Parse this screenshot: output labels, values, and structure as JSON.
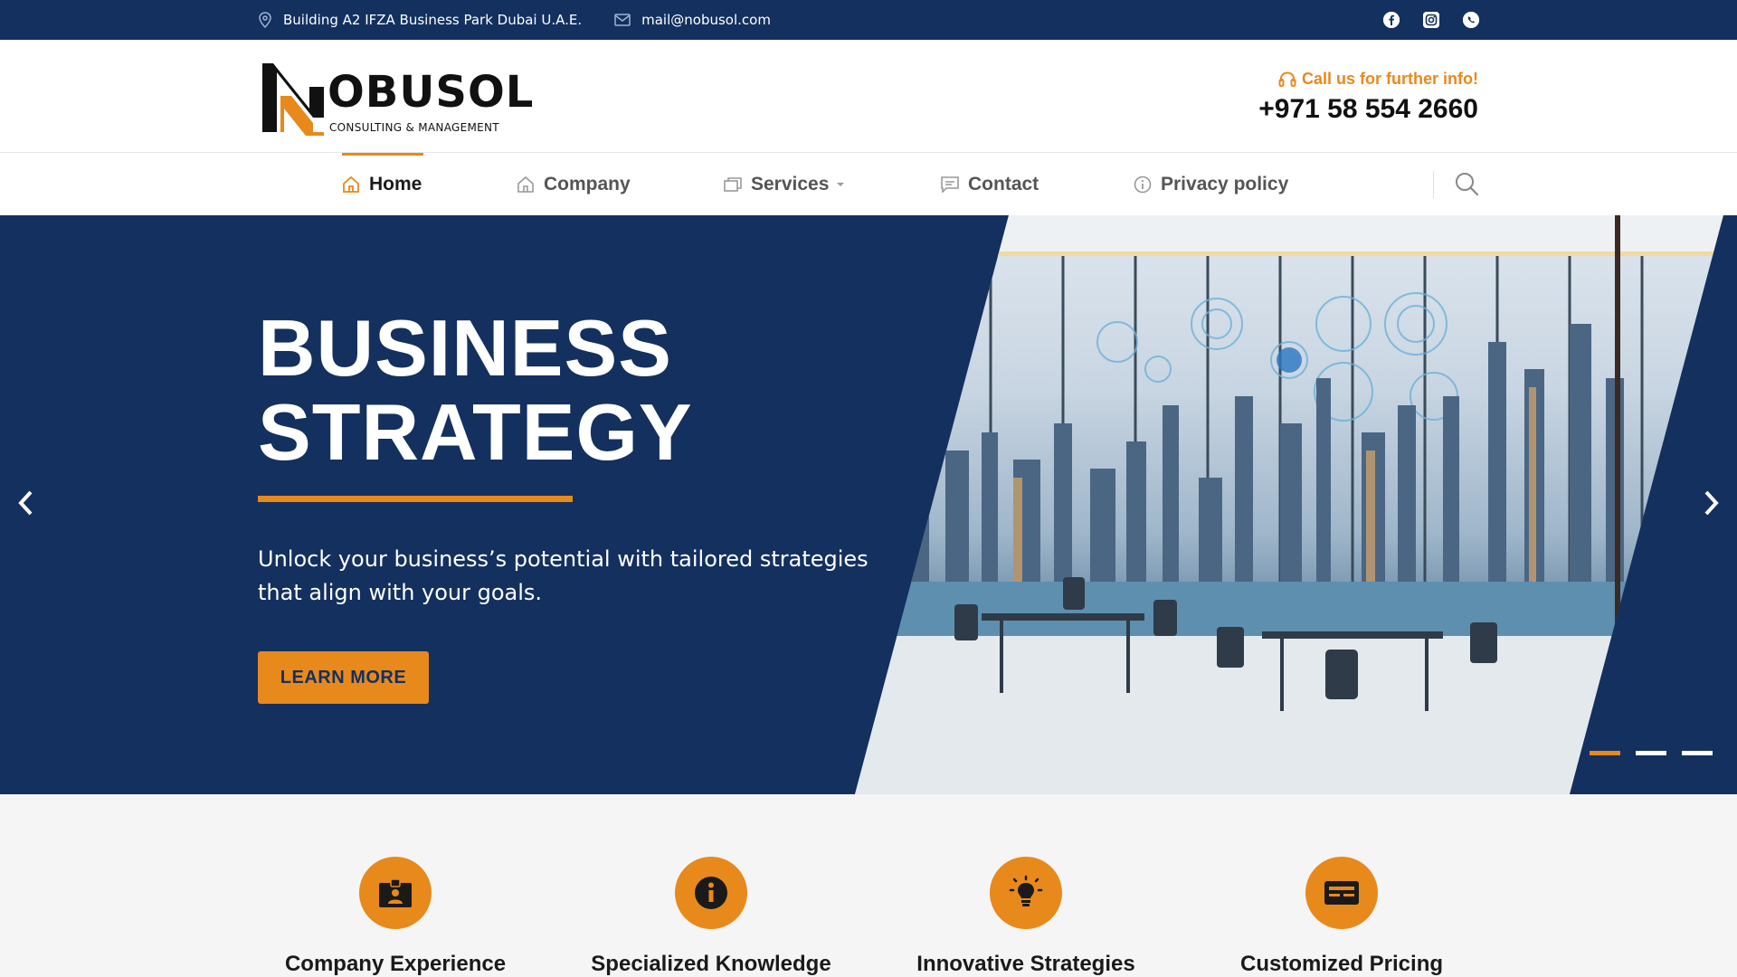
{
  "topbar": {
    "address": "Building A2 IFZA Business Park Dubai U.A.E.",
    "email": "mail@nobusol.com",
    "socials": [
      "facebook-icon",
      "instagram-icon",
      "whatsapp-icon"
    ]
  },
  "header": {
    "logo_text": "OBUSOL",
    "logo_sub": "CONSULTING & MANAGEMENT",
    "call_label": "Call us for further info!",
    "phone": "+971 58 554 2660"
  },
  "nav": {
    "items": [
      {
        "label": "Home",
        "icon": "home-icon",
        "active": true
      },
      {
        "label": "Company",
        "icon": "building-icon"
      },
      {
        "label": "Services",
        "icon": "services-icon",
        "dropdown": true
      },
      {
        "label": "Contact",
        "icon": "chat-icon"
      },
      {
        "label": "Privacy policy",
        "icon": "info-icon"
      }
    ]
  },
  "hero": {
    "title_line1": "BUSINESS",
    "title_line2": "STRATEGY",
    "text": "Unlock your business’s potential with tailored strategies that align with your goals.",
    "button": "LEARN MORE",
    "slides": 3,
    "active_slide": 1
  },
  "features": [
    {
      "title": "Company Experience",
      "icon": "id-badge-icon"
    },
    {
      "title": "Specialized Knowledge",
      "icon": "info-icon"
    },
    {
      "title": "Innovative Strategies",
      "icon": "lightbulb-icon"
    },
    {
      "title": "Customized Pricing",
      "icon": "card-icon"
    }
  ],
  "colors": {
    "navy": "#14305f",
    "accent": "#e8891c"
  }
}
